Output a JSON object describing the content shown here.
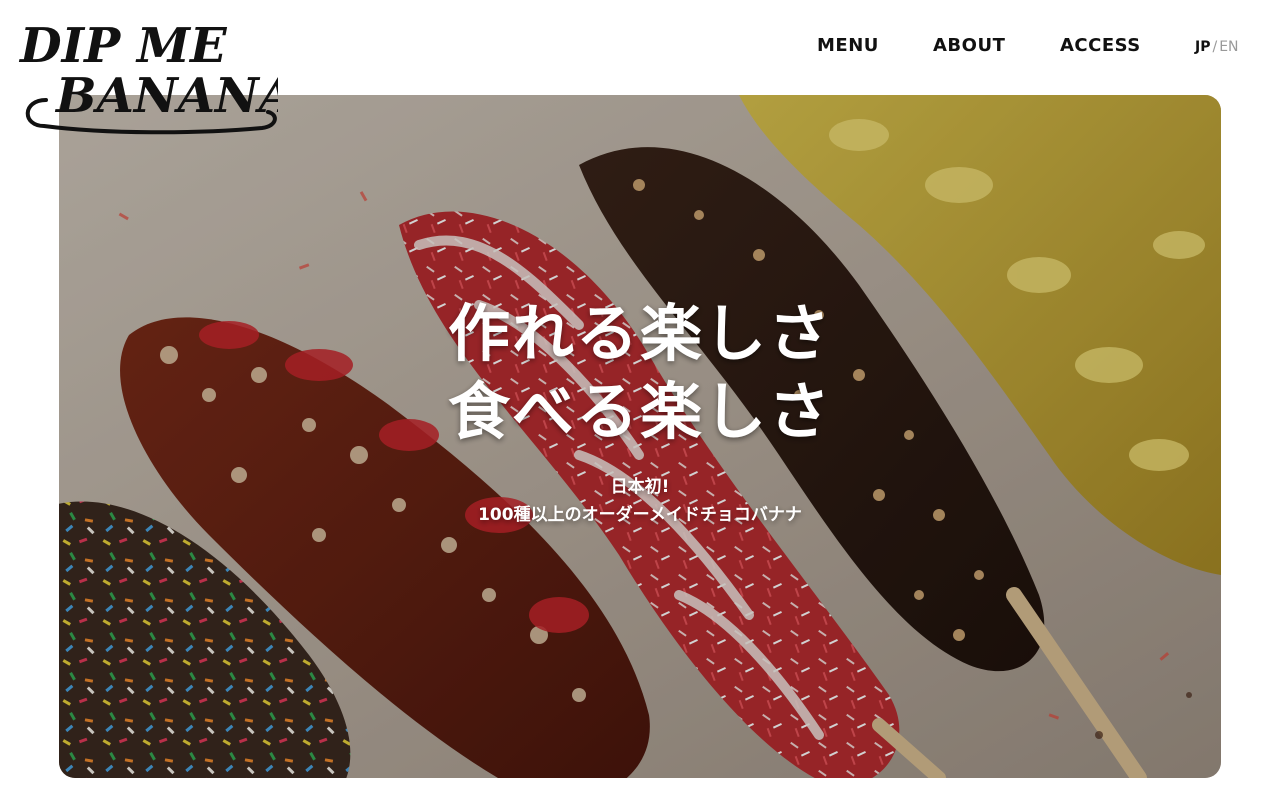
{
  "header": {
    "logo": {
      "line1": "DIP ME",
      "line2": "BANANA"
    },
    "nav": [
      {
        "label": "MENU"
      },
      {
        "label": "ABOUT"
      },
      {
        "label": "ACCESS"
      }
    ],
    "lang": {
      "active": "JP",
      "separator": "/",
      "other": "EN"
    }
  },
  "hero": {
    "headline_line1": "作れる楽しさ",
    "headline_line2": "食べる楽しさ",
    "sub_line1": "日本初!",
    "sub_line2": "100種以上のオーダーメイドチョコバナナ"
  },
  "colors": {
    "text": "#111111",
    "muted": "#999999",
    "hero_text": "#ffffff"
  }
}
